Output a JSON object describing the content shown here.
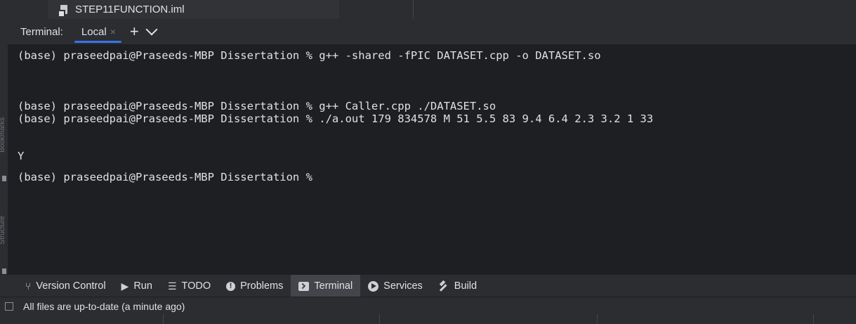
{
  "editor": {
    "file_tab_name": "STEP11FUNCTION.iml"
  },
  "left_stripe": {
    "bookmarks_label": "Bookmarks",
    "structure_label": "Structure"
  },
  "terminal": {
    "title": "Terminal:",
    "tab_label": "Local",
    "tab_close": "×",
    "new_tab": "+",
    "lines": [
      "(base) praseedpai@Praseeds-MBP Dissertation % g++ -shared -fPIC DATASET.cpp -o DATASET.so",
      "",
      "(base) praseedpai@Praseeds-MBP Dissertation % g++ Caller.cpp ./DATASET.so",
      "(base) praseedpai@Praseeds-MBP Dissertation % ./a.out 179 834578 M 51 5.5 83 9.4 6.4 2.3 3.2 1 33",
      "",
      "Y",
      "(base) praseedpai@Praseeds-MBP Dissertation % "
    ]
  },
  "tool_bar": {
    "items": [
      {
        "label": "Version Control",
        "icon": "vcs-branch-icon"
      },
      {
        "label": "Run",
        "icon": "run-icon"
      },
      {
        "label": "TODO",
        "icon": "todo-list-icon"
      },
      {
        "label": "Problems",
        "icon": "problems-icon"
      },
      {
        "label": "Terminal",
        "icon": "terminal-icon",
        "active": true
      },
      {
        "label": "Services",
        "icon": "services-icon"
      },
      {
        "label": "Build",
        "icon": "build-hammer-icon"
      }
    ]
  },
  "status_bar": {
    "text": "All files are up-to-date (a minute ago)"
  }
}
